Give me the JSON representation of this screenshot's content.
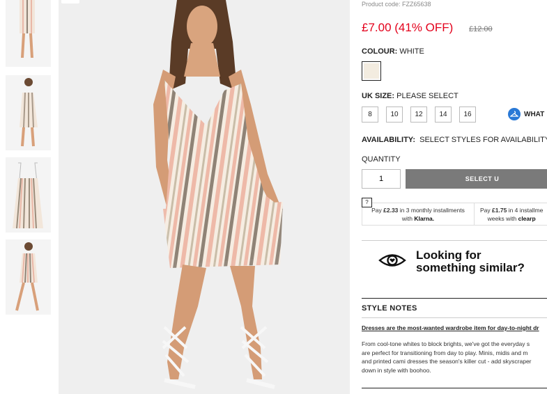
{
  "product": {
    "code": "Product code: FZZ65638",
    "price": "£7.00 (41% OFF)",
    "was_price": "£12.00"
  },
  "colour": {
    "label": "COLOUR:",
    "value": "WHITE",
    "swatch_color": "#f3ece0"
  },
  "size": {
    "label": "UK SIZE:",
    "value": "PLEASE SELECT",
    "options": [
      "8",
      "10",
      "12",
      "14",
      "16"
    ],
    "guide_label": "WHAT"
  },
  "availability": {
    "label": "AVAILABILITY:",
    "value": "SELECT STYLES FOR AVAILABILITY"
  },
  "quantity": {
    "label": "QUANTITY",
    "value": "1"
  },
  "actions": {
    "select_label": "SELECT U"
  },
  "payments": {
    "help": "?",
    "klarna_pre": "Pay",
    "klarna_amount": "£2.33",
    "klarna_mid": "in 3 monthly installments with",
    "klarna_brand": "Klarna.",
    "clearpay_pre": "Pay",
    "clearpay_amount": "£1.75",
    "clearpay_mid": "in 4 installme",
    "clearpay_line2": "weeks with",
    "clearpay_brand": "clearp"
  },
  "similar": {
    "text_line1": "Looking for",
    "text_line2": "something similar?"
  },
  "style_notes": {
    "title": "STYLE NOTES",
    "lead": "Dresses are the most-wanted wardrobe item for day-to-night dr",
    "body_line1": "From cool-tone whites to block brights, we've got the everyday s",
    "body_line2": "are perfect for transitioning from day to play. Minis, midis and m",
    "body_line3": "and printed cami dresses the season's killer cut - add skyscraper",
    "body_line4": "down in style with boohoo."
  },
  "colors": {
    "accent_red": "#e3001b",
    "button_grey": "#7a7a7a",
    "size_guide_blue": "#2a79d6"
  },
  "icons": [
    "eye-icon",
    "hanger-icon",
    "help-icon"
  ]
}
